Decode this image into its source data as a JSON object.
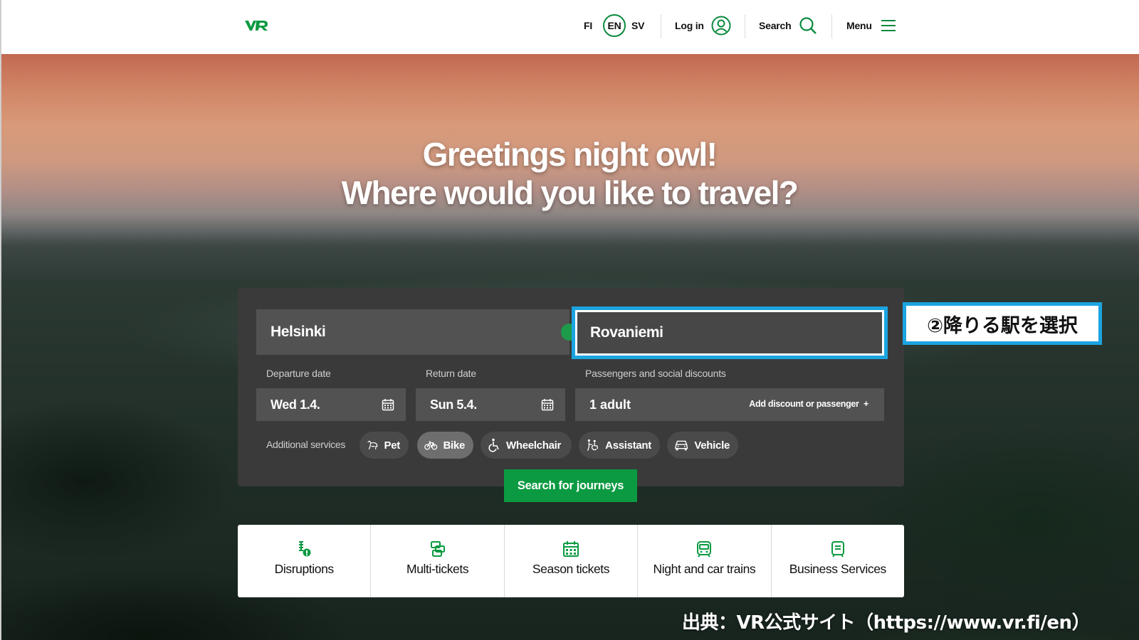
{
  "header": {
    "logo": "VR",
    "languages": [
      "FI",
      "EN",
      "SV"
    ],
    "login_label": "Log in",
    "search_label": "Search",
    "menu_label": "Menu"
  },
  "hero": {
    "line1": "Greetings night owl!",
    "line2": "Where would you like to travel?"
  },
  "booking": {
    "from_value": "Helsinki",
    "to_value": "Rovaniemi",
    "departure_label": "Departure date",
    "departure_value": "Wed 1.4.",
    "return_label": "Return date",
    "return_value": "Sun 5.4.",
    "passengers_label": "Passengers and social discounts",
    "passengers_value": "1 adult",
    "add_discount_label": "Add discount or passenger",
    "additional_services_label": "Additional services",
    "services": [
      {
        "label": "Pet",
        "icon": "pet-icon",
        "active": false
      },
      {
        "label": "Bike",
        "icon": "bike-icon",
        "active": true
      },
      {
        "label": "Wheelchair",
        "icon": "wheelchair-icon",
        "active": false
      },
      {
        "label": "Assistant",
        "icon": "assistant-icon",
        "active": false
      },
      {
        "label": "Vehicle",
        "icon": "vehicle-icon",
        "active": false
      }
    ],
    "search_button": "Search for journeys"
  },
  "quick_links": [
    {
      "label": "Disruptions",
      "icon": "disruptions-icon"
    },
    {
      "label": "Multi-tickets",
      "icon": "multi-tickets-icon"
    },
    {
      "label": "Season tickets",
      "icon": "season-tickets-icon"
    },
    {
      "label": "Night and car trains",
      "icon": "train-icon"
    },
    {
      "label": "Business Services",
      "icon": "business-icon"
    }
  ],
  "annotation": {
    "callout": "②降りる駅を選択",
    "credit": "出典：VR公式サイト（https://www.vr.fi/en）"
  },
  "colors": {
    "brand_green": "#0b9a41",
    "highlight_blue": "#1ba4e0",
    "panel_bg": "#3a3a3a"
  }
}
